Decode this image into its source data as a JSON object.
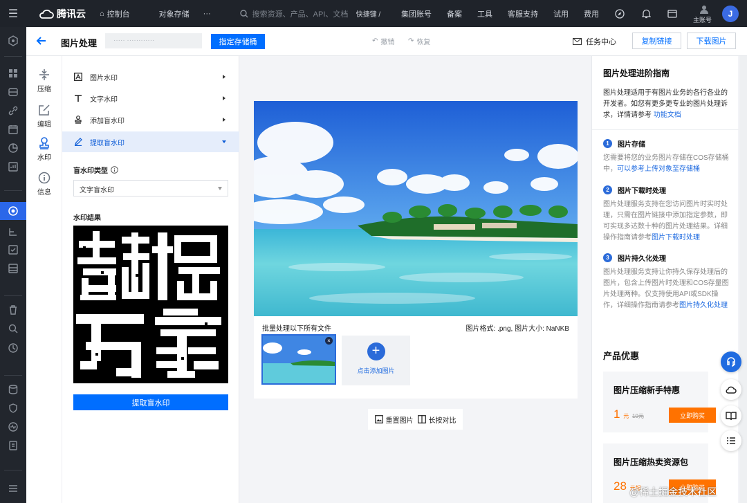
{
  "topbar": {
    "brand": "腾讯云",
    "console": "控制台",
    "product": "对象存储",
    "more": "···",
    "search_placeholder": "搜索资源、产品、API、文档",
    "shortcut": "快捷键 /",
    "right_items": [
      "集团账号",
      "备案",
      "工具",
      "客服支持",
      "试用",
      "费用"
    ],
    "account_label": "主账号",
    "avatar_letter": "J"
  },
  "header": {
    "title": "图片处理",
    "spec_button": "指定存储桶",
    "undo": "撤销",
    "redo": "恢复",
    "task_center": "任务中心",
    "copy_link": "复制链接",
    "download": "下载图片"
  },
  "tools": [
    {
      "label": "压缩",
      "icon": "compress-icon"
    },
    {
      "label": "编辑",
      "icon": "edit-icon"
    },
    {
      "label": "水印",
      "icon": "watermark-icon"
    },
    {
      "label": "信息",
      "icon": "info-icon"
    }
  ],
  "panel": {
    "items": [
      {
        "label": "图片水印",
        "icon": "image-watermark-icon"
      },
      {
        "label": "文字水印",
        "icon": "text-watermark-icon"
      },
      {
        "label": "添加盲水印",
        "icon": "add-blind-watermark-icon"
      },
      {
        "label": "提取盲水印",
        "icon": "extract-blind-watermark-icon"
      }
    ],
    "type_label": "盲水印类型",
    "type_value": "文字盲水印",
    "result_label": "水印结果",
    "extract_button": "提取盲水印"
  },
  "canvas": {
    "batch_text": "批量处理以下所有文件",
    "format_text": "图片格式: .png, 图片大小: NaNKB",
    "add_image": "点击添加图片",
    "reset": "重置图片",
    "compare": "长按对比"
  },
  "guide": {
    "title": "图片处理进阶指南",
    "desc": "图片处理适用于有图片业务的各行各业的开发者。如您有更多更专业的图片处理诉求，详情请参考",
    "desc_link": "功能文档",
    "steps": [
      {
        "n": "1",
        "title": "图片存储",
        "desc": "您需要将您的业务图片存储在COS存储桶中，",
        "link": "可以参考上传对象至存储桶"
      },
      {
        "n": "2",
        "title": "图片下载时处理",
        "desc": "图片处理服务支持在您访问图片时实时处理，只需在图片链接中添加指定参数，即可实现多达数十种的图片处理结果。详细操作指南请参考",
        "link": "图片下载时处理"
      },
      {
        "n": "3",
        "title": "图片持久化处理",
        "desc": "图片处理服务支持让你持久保存处理后的图片，包含上传图片时处理和COS存量图片处理两种。仅支持使用API或SDK操作，详细操作指南请参考",
        "link": "图片持久化处理"
      }
    ],
    "promo_title": "产品优惠",
    "promos": [
      {
        "title": "图片压缩新手特惠",
        "price": "1",
        "unit": "元",
        "orig": "10元",
        "button": "立即购买"
      },
      {
        "title": "图片压缩热卖资源包",
        "price": "28",
        "unit": "元起",
        "orig": "",
        "button": "立即购买"
      }
    ]
  },
  "watermark_footer": "@稀土掘金技术社区",
  "colors": {
    "primary": "#006eff",
    "topbar": "#1f232a",
    "orange": "#ff7200"
  }
}
